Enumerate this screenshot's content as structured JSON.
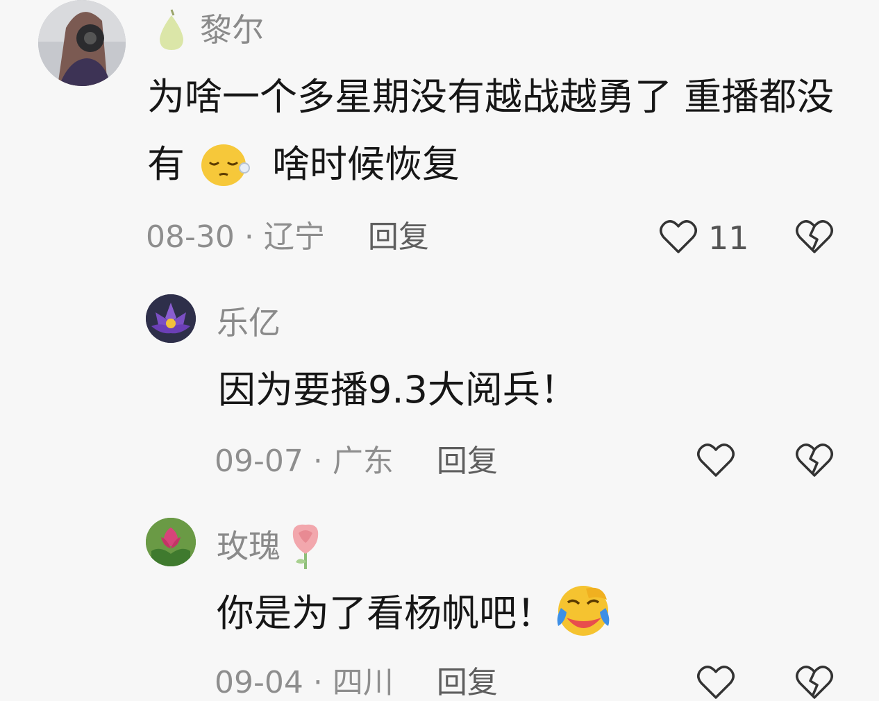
{
  "comments": [
    {
      "author": "黎尔",
      "text_line1": "为啥一个多星期没有越战越勇了 重播都没",
      "text_line2_a": "有",
      "text_line2_b": "啥时候恢复",
      "date": "08-30",
      "dot": "·",
      "location": "辽宁",
      "reply_label": "回复",
      "like_count": "11",
      "emoji_icon": "sleepy-face-icon"
    },
    {
      "author": "乐亿",
      "text": "因为要播9.3大阅兵！",
      "date": "09-07",
      "dot": "·",
      "location": "广东",
      "reply_label": "回复"
    },
    {
      "author": "玫瑰",
      "text": "你是为了看杨帆吧！",
      "date": "09-04",
      "dot": "·",
      "location": "四川",
      "reply_label": "回复",
      "emoji_icon": "crying-laughing-icon"
    }
  ],
  "colors": {
    "text": "#161616",
    "muted": "#8e8e8e",
    "background": "#f7f7f7"
  }
}
